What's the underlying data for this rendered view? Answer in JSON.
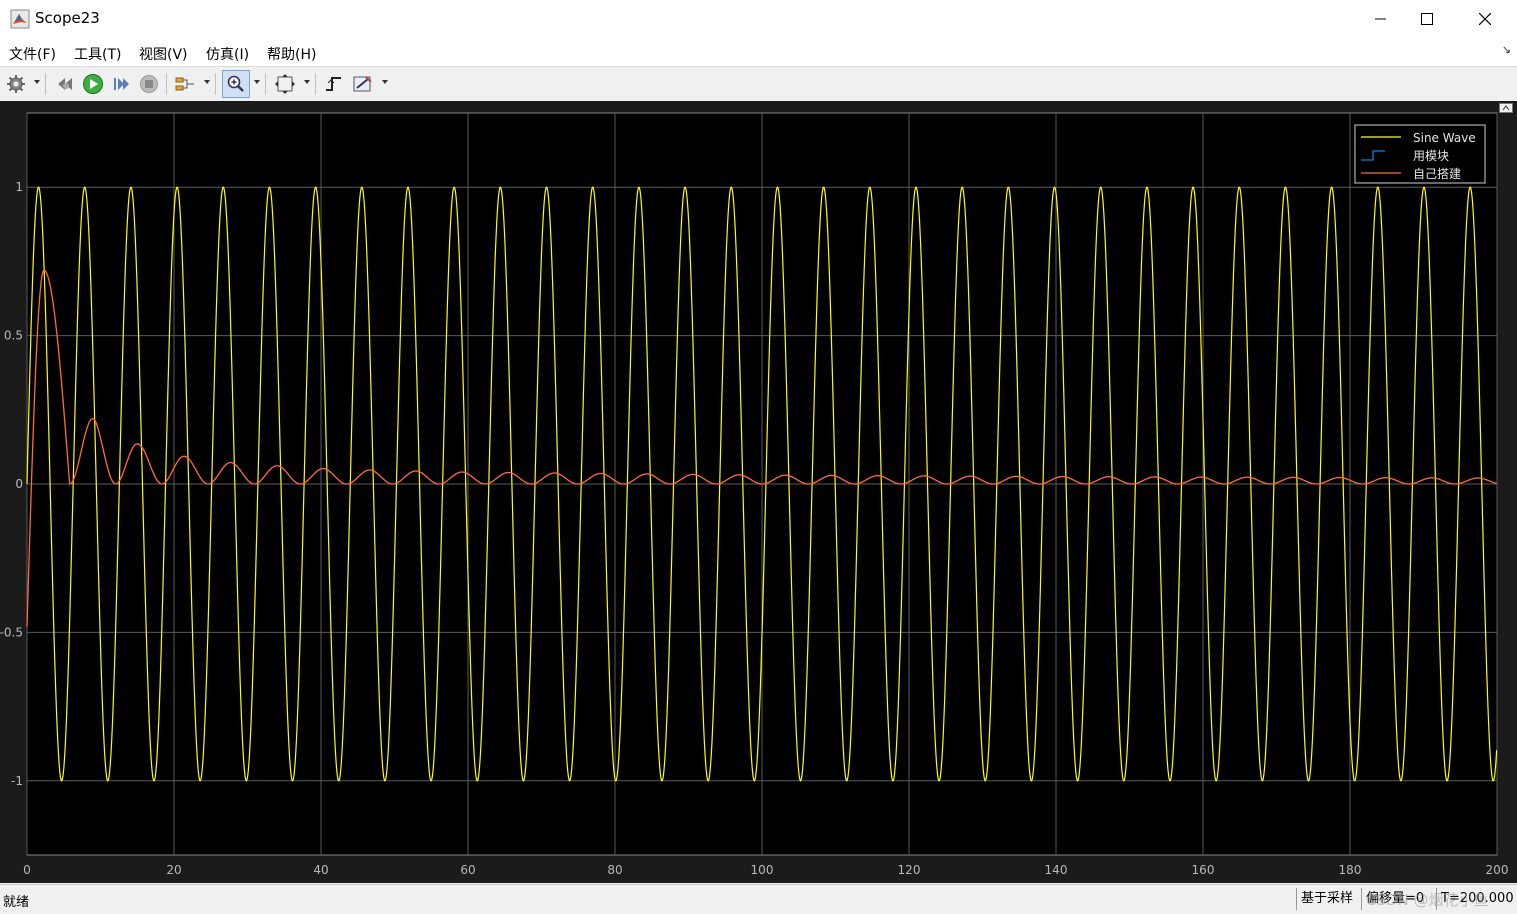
{
  "window": {
    "title": "Scope23"
  },
  "menu": [
    "文件(F)",
    "工具(T)",
    "视图(V)",
    "仿真(I)",
    "帮助(H)"
  ],
  "toolbar": {
    "icons": [
      "gear-icon",
      "step-back-icon",
      "run-icon",
      "step-forward-icon",
      "stop-icon",
      "signal-selector-icon",
      "zoom-in-icon",
      "fit-axes-icon",
      "trigger-icon",
      "measure-icon"
    ],
    "active": "zoom-in-icon"
  },
  "status": {
    "left": "就绪",
    "sampling": "基于采样",
    "offset": "偏移量=0",
    "time": "T=200.000",
    "watermark": "CSDN @烟花小鱼"
  },
  "colors": {
    "plot_bg": "#000000",
    "figure_bg": "#1b1b1b",
    "grid": "#5a5a5a",
    "axis_text": "#b9b9b9",
    "sine": "#ffff00",
    "block": "#0072bd",
    "custom": "#ff6b3a"
  },
  "chart_data": {
    "type": "line",
    "xlim": [
      0,
      200
    ],
    "ylim": [
      -1.25,
      1.25
    ],
    "xticks": [
      0,
      20,
      40,
      60,
      80,
      100,
      120,
      140,
      160,
      180,
      200
    ],
    "yticks": [
      -1,
      -0.5,
      0,
      0.5,
      1
    ],
    "ytick_labels": [
      "-1",
      "-0.5",
      "0",
      "0.5",
      "1"
    ],
    "grid": true,
    "legend_position": "top-right",
    "series": [
      {
        "name": "Sine Wave",
        "color": "#ffff00",
        "frequency_rad_per_s": 1,
        "amplitude": 1,
        "period": 6.283
      },
      {
        "name": "用模块",
        "color": "#0072bd",
        "style": "step",
        "note_visible": "legend only"
      },
      {
        "name": "自己搭建",
        "color": "#ff6b3a",
        "peaks": [
          [
            0,
            -0.48
          ],
          [
            2.3,
            0.72
          ],
          [
            5.8,
            0.0
          ],
          [
            9.2,
            0.22
          ],
          [
            15.5,
            0.13
          ],
          [
            22,
            0.09
          ],
          [
            28.5,
            0.07
          ],
          [
            35,
            0.06
          ],
          [
            41.5,
            0.05
          ],
          [
            60,
            0.04
          ],
          [
            100,
            0.03
          ],
          [
            140,
            0.025
          ],
          [
            200,
            0.02
          ]
        ],
        "period": 6.283,
        "final_value": 0.0
      }
    ]
  }
}
